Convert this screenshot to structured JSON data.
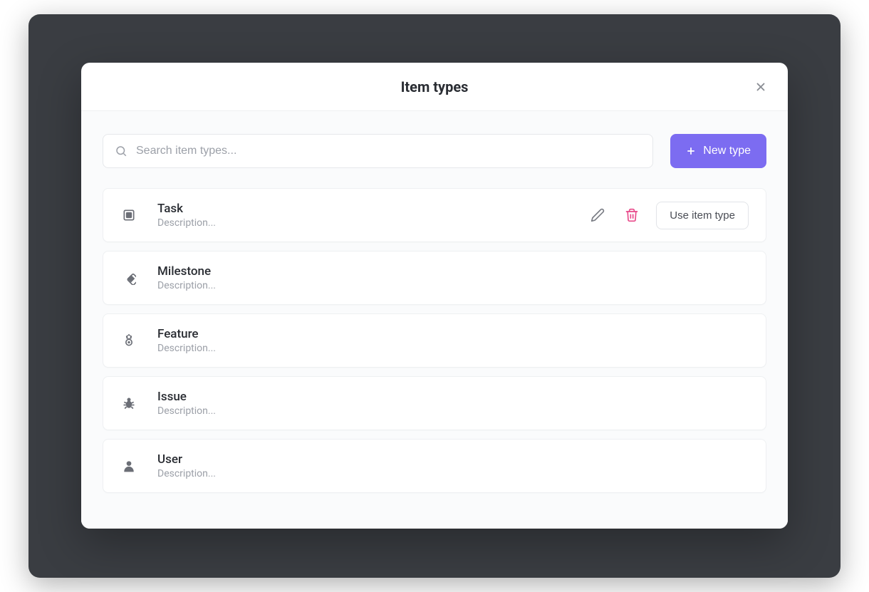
{
  "modal": {
    "title": "Item types",
    "search_placeholder": "Search item types...",
    "new_type_label": "New type",
    "use_label": "Use item type"
  },
  "types": [
    {
      "name": "Task",
      "description": "Description...",
      "icon": "task",
      "hovered": true
    },
    {
      "name": "Milestone",
      "description": "Description...",
      "icon": "milestone",
      "hovered": false
    },
    {
      "name": "Feature",
      "description": "Description...",
      "icon": "feature",
      "hovered": false
    },
    {
      "name": "Issue",
      "description": "Description...",
      "icon": "issue",
      "hovered": false
    },
    {
      "name": "User",
      "description": "Description...",
      "icon": "user",
      "hovered": false
    }
  ],
  "colors": {
    "primary": "#7c6cf1",
    "danger": "#e84a8a"
  }
}
